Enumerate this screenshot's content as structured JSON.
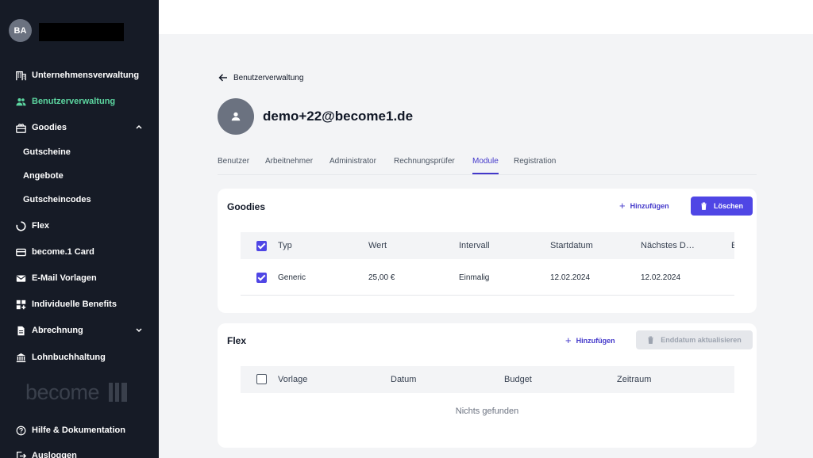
{
  "user": {
    "initials": "BA"
  },
  "sidebar": {
    "items": [
      {
        "label": "Unternehmensverwaltung",
        "icon": "building-icon"
      },
      {
        "label": "Benutzerverwaltung",
        "icon": "users-icon",
        "active": true
      },
      {
        "label": "Goodies",
        "icon": "gift-icon",
        "expanded": true
      },
      {
        "label": "Flex",
        "icon": "circle-icon"
      },
      {
        "label": "become.1 Card",
        "icon": "card-icon"
      },
      {
        "label": "E-Mail Vorlagen",
        "icon": "mail-icon"
      },
      {
        "label": "Individuelle Benefits",
        "icon": "grid-plus-icon"
      },
      {
        "label": "Abrechnung",
        "icon": "document-icon",
        "expanded": false
      },
      {
        "label": "Lohnbuchhaltung",
        "icon": "bank-icon"
      }
    ],
    "sub_items": [
      "Gutscheine",
      "Angebote",
      "Gutscheincodes"
    ],
    "brand": "become",
    "help_label": "Hilfe & Dokumentation",
    "logout_label": "Ausloggen"
  },
  "page": {
    "back_label": "Benutzerverwaltung",
    "title": "demo+22@become1.de",
    "tabs": [
      "Benutzer",
      "Arbeitnehmer",
      "Administrator",
      "Rechnungsprüfer",
      "Module",
      "Registration"
    ],
    "active_tab": "Module"
  },
  "goodies": {
    "title": "Goodies",
    "add_label": "Hinzufügen",
    "delete_label": "Löschen",
    "columns": [
      "Typ",
      "Wert",
      "Intervall",
      "Startdatum",
      "Nächstes D…",
      "E"
    ],
    "rows": [
      {
        "typ": "Generic",
        "wert": "25,00 €",
        "intervall": "Einmalig",
        "start": "12.02.2024",
        "next": "12.02.2024",
        "checked": true
      }
    ]
  },
  "flex": {
    "title": "Flex",
    "add_label": "Hinzufügen",
    "update_label": "Enddatum aktualisieren",
    "columns": [
      "Vorlage",
      "Datum",
      "Budget",
      "Zeitraum"
    ],
    "empty": "Nichts gefunden"
  },
  "colors": {
    "accent": "#4f46e5",
    "sidebar_bg": "#161b26",
    "active_nav": "#5cd6a0"
  }
}
